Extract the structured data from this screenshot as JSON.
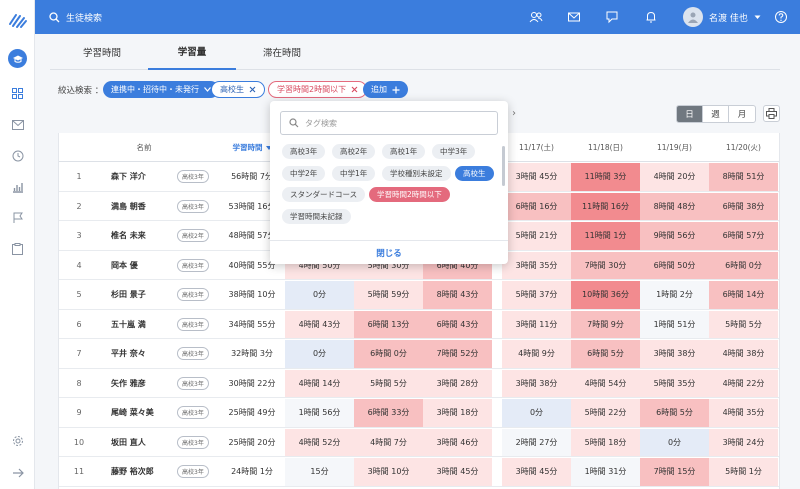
{
  "header": {
    "search_label": "生徒検索",
    "user_name": "名渡 佳也"
  },
  "tabs": [
    {
      "label": "学習時間",
      "active": false
    },
    {
      "label": "学習量",
      "active": true
    },
    {
      "label": "滞在時間",
      "active": false
    }
  ],
  "filter": {
    "label": "絞込検索 ：",
    "chips": [
      {
        "label": "連携中・招待中・未発行",
        "style": "blue"
      },
      {
        "label": "高校生",
        "style": "outline-blue"
      },
      {
        "label": "学習時間2時間以下",
        "style": "outline-red"
      },
      {
        "label": "追加",
        "style": "blue"
      }
    ]
  },
  "view_toggle": {
    "options": [
      "日",
      "週",
      "月"
    ],
    "selected": "日"
  },
  "popover": {
    "search_placeholder": "タグ検索",
    "tags": [
      {
        "label": "高校3年",
        "state": "normal"
      },
      {
        "label": "高校2年",
        "state": "normal"
      },
      {
        "label": "高校1年",
        "state": "normal"
      },
      {
        "label": "中学3年",
        "state": "normal"
      },
      {
        "label": "中学2年",
        "state": "normal"
      },
      {
        "label": "中学1年",
        "state": "normal"
      },
      {
        "label": "学校種別未設定",
        "state": "normal"
      },
      {
        "label": "高校生",
        "state": "selected-blue"
      },
      {
        "label": "スタンダードコース",
        "state": "normal"
      },
      {
        "label": "学習時間2時間以下",
        "state": "selected-red"
      },
      {
        "label": "学習時間未記録",
        "state": "normal"
      }
    ],
    "close_label": "閉じる"
  },
  "table": {
    "col_name": "名前",
    "col_total": "学習時間",
    "dates": [
      "11/17(土)",
      "11/18(日)",
      "11/19(月)",
      "11/20(火)"
    ],
    "rows": [
      {
        "no": "1",
        "name": "森下 洋介",
        "grade": "高校3年",
        "total": "56時間 7分",
        "d1": "",
        "d2": "",
        "d3": "",
        "d4": "3時間 45分",
        "d5": "11時間 3分",
        "d6": "4時間 20分",
        "d7": "8時間 51分"
      },
      {
        "no": "2",
        "name": "満島 朝香",
        "grade": "高校3年",
        "total": "53時間 16分",
        "d1": "",
        "d2": "",
        "d3": "",
        "d4": "6時間 16分",
        "d5": "11時間 16分",
        "d6": "8時間 48分",
        "d7": "6時間 38分"
      },
      {
        "no": "3",
        "name": "椎名 未来",
        "grade": "高校2年",
        "total": "48時間 57分",
        "d1": "",
        "d2": "",
        "d3": "",
        "d4": "5時間 21分",
        "d5": "11時間 1分",
        "d6": "9時間 56分",
        "d7": "6時間 57分"
      },
      {
        "no": "4",
        "name": "岡本 優",
        "grade": "高校3年",
        "total": "40時間 55分",
        "d1": "4時間 50分",
        "d2": "5時間 30分",
        "d3": "6時間 40分",
        "d4": "3時間 35分",
        "d5": "7時間 30分",
        "d6": "6時間 50分",
        "d7": "6時間 0分"
      },
      {
        "no": "5",
        "name": "杉田 景子",
        "grade": "高校3年",
        "total": "38時間 10分",
        "d1": "0分",
        "d2": "5時間 59分",
        "d3": "8時間 43分",
        "d4": "5時間 37分",
        "d5": "10時間 36分",
        "d6": "1時間 2分",
        "d7": "6時間 14分"
      },
      {
        "no": "6",
        "name": "五十嵐 満",
        "grade": "高校3年",
        "total": "34時間 55分",
        "d1": "4時間 43分",
        "d2": "6時間 13分",
        "d3": "6時間 43分",
        "d4": "3時間 11分",
        "d5": "7時間 9分",
        "d6": "1時間 51分",
        "d7": "5時間 5分"
      },
      {
        "no": "7",
        "name": "平井 奈々",
        "grade": "高校3年",
        "total": "32時間 3分",
        "d1": "0分",
        "d2": "6時間 0分",
        "d3": "7時間 52分",
        "d4": "4時間 9分",
        "d5": "6時間 5分",
        "d6": "3時間 38分",
        "d7": "4時間 38分"
      },
      {
        "no": "8",
        "name": "矢作 雅彦",
        "grade": "高校3年",
        "total": "30時間 22分",
        "d1": "4時間 14分",
        "d2": "5時間 5分",
        "d3": "3時間 28分",
        "d4": "3時間 38分",
        "d5": "4時間 54分",
        "d6": "5時間 35分",
        "d7": "4時間 22分"
      },
      {
        "no": "9",
        "name": "尾崎 菜々美",
        "grade": "高校3年",
        "total": "25時間 49分",
        "d1": "1時間 56分",
        "d2": "6時間 33分",
        "d3": "3時間 18分",
        "d4": "0分",
        "d5": "5時間 22分",
        "d6": "6時間 5分",
        "d7": "4時間 35分"
      },
      {
        "no": "10",
        "name": "坂田 直人",
        "grade": "高校3年",
        "total": "25時間 20分",
        "d1": "4時間 52分",
        "d2": "4時間 7分",
        "d3": "3時間 46分",
        "d4": "2時間 27分",
        "d5": "5時間 18分",
        "d6": "0分",
        "d7": "3時間 24分"
      },
      {
        "no": "11",
        "name": "藤野 裕次郎",
        "grade": "高校3年",
        "total": "24時間 1分",
        "d1": "15分",
        "d2": "3時間 10分",
        "d3": "3時間 45分",
        "d4": "3時間 45分",
        "d5": "1時間 31分",
        "d6": "7時間 15分",
        "d7": "5時間 1分"
      }
    ]
  },
  "colors": {
    "accent": "#3b7ddd",
    "heat_high": "#f28b8f",
    "heat_mid": "#f8c0c1",
    "heat_low": "#fde4e4",
    "heat_zero": "#e4ebf7"
  }
}
